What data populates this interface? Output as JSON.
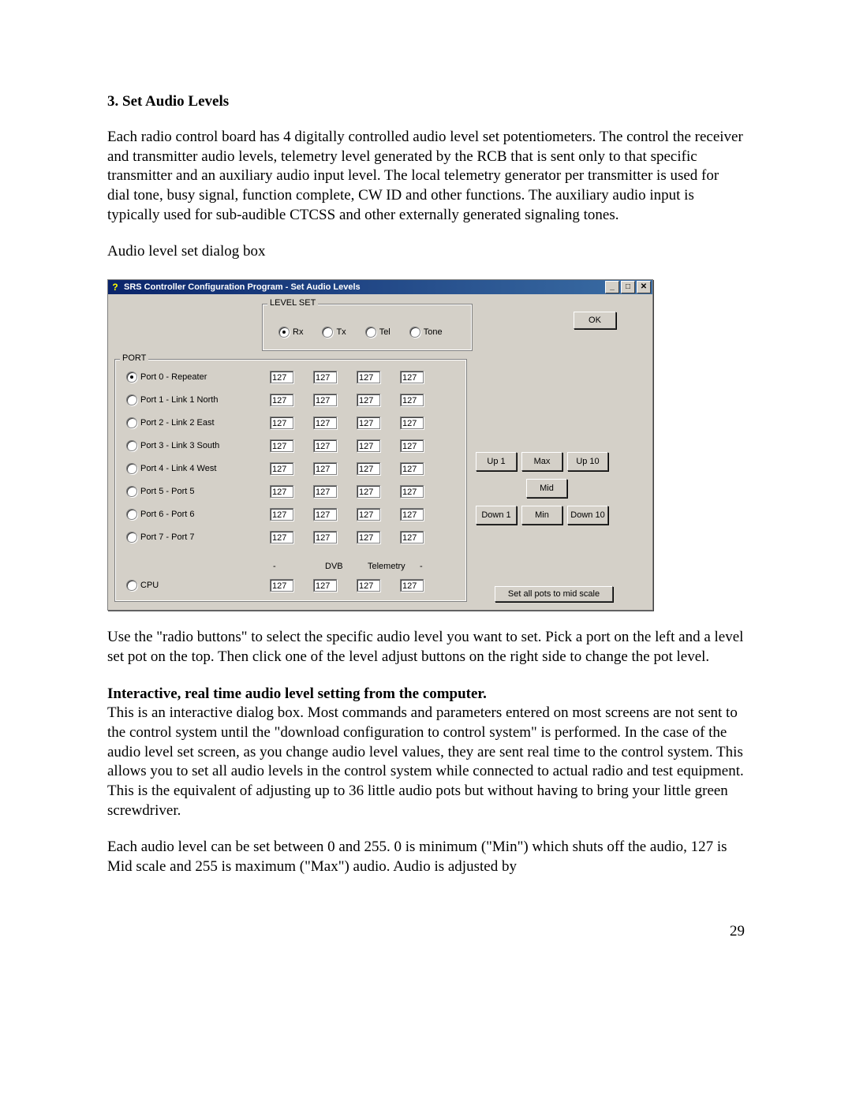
{
  "doc": {
    "heading": "3.  Set Audio Levels",
    "p1": "Each radio control board has 4 digitally controlled audio level set potentiometers.  The control the receiver and transmitter audio levels, telemetry level generated by the RCB that is sent only to that specific transmitter and an auxiliary audio input level.  The local telemetry generator per transmitter is used for dial tone,  busy signal, function complete, CW ID and other functions.  The auxiliary audio input is typically used for sub-audible CTCSS and other externally generated signaling tones.",
    "caption": "Audio level set dialog box",
    "p2": "Use the \"radio buttons\" to select the specific audio level you want to set.  Pick a port on the left and a level set pot on the top.  Then click one of the level adjust buttons on the right side to change the pot level.",
    "sub_heading": "Interactive, real time audio level setting from the computer.",
    "p3": "This is an interactive dialog box.  Most commands and parameters entered on most screens are not sent to the control system until the \"download configuration to control system\" is performed.  In the case of the audio level set screen, as you change audio level values, they are sent real time to the control system.  This allows you to set all audio levels in the control system while connected to actual radio and test equipment.  This is the equivalent of adjusting up to 36 little audio pots but without having to bring your little green screwdriver.",
    "p4": "Each audio level can be set between 0 and 255.  0 is minimum (\"Min\") which shuts off the audio, 127 is Mid scale and 255 is maximum (\"Max\") audio.  Audio is adjusted by",
    "page_number": "29"
  },
  "dialog": {
    "title": "SRS Controller Configuration Program - Set Audio Levels",
    "ok_label": "OK",
    "levelset_title": "LEVEL SET",
    "levelset_options": [
      "Rx",
      "Tx",
      "Tel",
      "Tone"
    ],
    "levelset_selected": 0,
    "port_title": "PORT",
    "ports": [
      {
        "label": "Port 0 - Repeater",
        "selected": true,
        "vals": [
          "127",
          "127",
          "127",
          "127"
        ]
      },
      {
        "label": "Port 1 - Link 1 North",
        "selected": false,
        "vals": [
          "127",
          "127",
          "127",
          "127"
        ]
      },
      {
        "label": "Port 2 - Link 2 East",
        "selected": false,
        "vals": [
          "127",
          "127",
          "127",
          "127"
        ]
      },
      {
        "label": "Port 3 - Link 3 South",
        "selected": false,
        "vals": [
          "127",
          "127",
          "127",
          "127"
        ]
      },
      {
        "label": "Port 4 - Link 4 West",
        "selected": false,
        "vals": [
          "127",
          "127",
          "127",
          "127"
        ]
      },
      {
        "label": "Port 5 - Port 5",
        "selected": false,
        "vals": [
          "127",
          "127",
          "127",
          "127"
        ]
      },
      {
        "label": "Port 6 - Port 6",
        "selected": false,
        "vals": [
          "127",
          "127",
          "127",
          "127"
        ]
      },
      {
        "label": "Port 7 - Port 7",
        "selected": false,
        "vals": [
          "127",
          "127",
          "127",
          "127"
        ]
      }
    ],
    "cpu": {
      "label": "CPU",
      "selected": false,
      "vals": [
        "127",
        "127",
        "127",
        "127"
      ]
    },
    "cpu_headers": [
      "-",
      "DVB",
      "Telemetry",
      "-"
    ],
    "adjust": {
      "up1": "Up 1",
      "max": "Max",
      "up10": "Up 10",
      "mid": "Mid",
      "down1": "Down 1",
      "min": "Min",
      "down10": "Down 10"
    },
    "set_all": "Set all pots to mid scale"
  }
}
